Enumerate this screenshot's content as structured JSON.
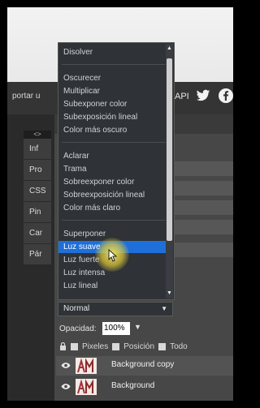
{
  "header": {
    "left_text": "portar u",
    "api_label": "API"
  },
  "side_tabs": [
    "Inf",
    "Pro",
    "CSS",
    "Pin",
    "Car",
    "Pár"
  ],
  "side_handle": "<>",
  "blend_menu": {
    "items": [
      {
        "label": "Disolver"
      },
      {
        "label": "Oscurecer"
      },
      {
        "label": "Multiplicar"
      },
      {
        "label": "Subexponer color"
      },
      {
        "label": "Subexposición lineal"
      },
      {
        "label": "Color más oscuro"
      },
      {
        "label": "Aclarar"
      },
      {
        "label": "Trama"
      },
      {
        "label": "Sobreexponer color"
      },
      {
        "label": "Sobreexposición lineal"
      },
      {
        "label": "Color más claro"
      },
      {
        "label": "Superponer"
      },
      {
        "label": "Luz suave",
        "selected": true
      },
      {
        "label": "Luz fuerte"
      },
      {
        "label": "Luz intensa"
      },
      {
        "label": "Luz lineal"
      }
    ],
    "scroll_up": "▲",
    "scroll_down": "▼"
  },
  "blend_select": {
    "value": "Normal",
    "caret": "▼"
  },
  "opacity": {
    "label": "Opacidad:",
    "value": "100%",
    "caret": "▼"
  },
  "lock": {
    "options": [
      "Pixeles",
      "Posición",
      "Todo"
    ]
  },
  "layers": [
    {
      "name": "Background copy"
    },
    {
      "name": "Background"
    }
  ],
  "colors": {
    "accent_selected": "#1e6fd9",
    "menu_bg": "#2f3236"
  }
}
